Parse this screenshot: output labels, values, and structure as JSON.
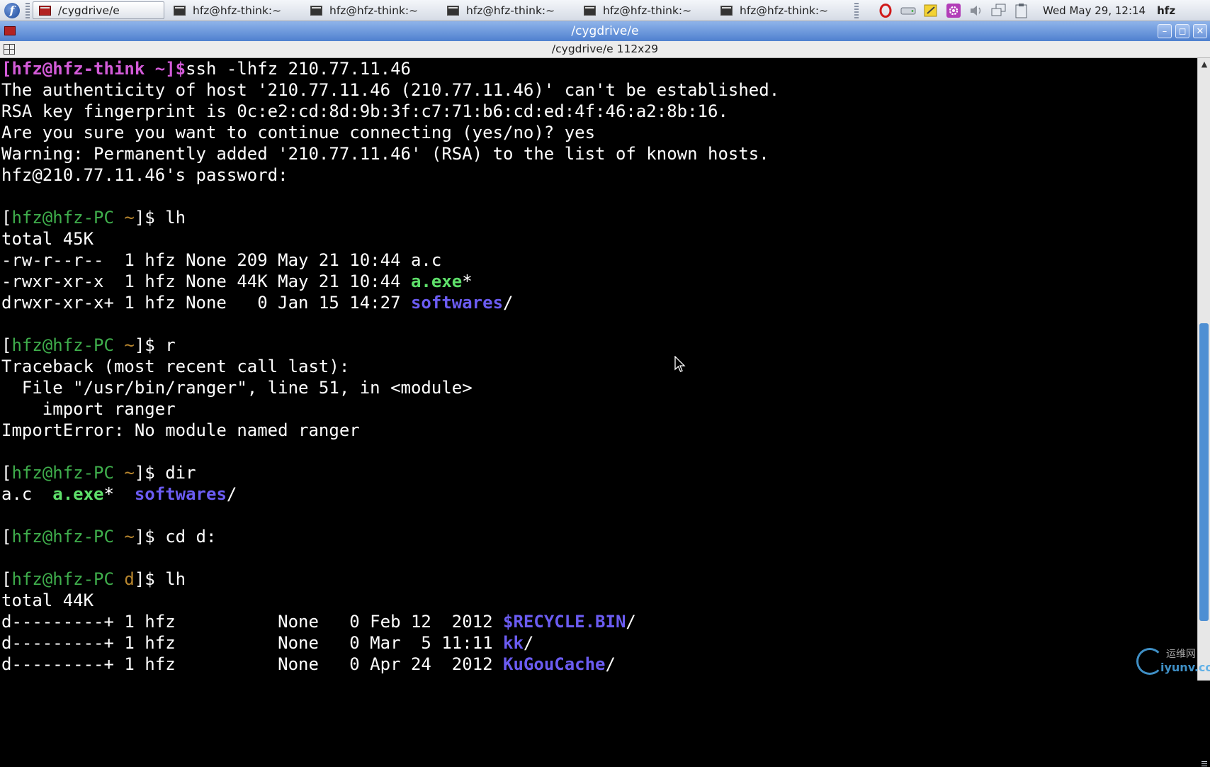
{
  "taskbar": {
    "start_label": "f",
    "tasks": [
      {
        "label": "/cygdrive/e",
        "active": true
      },
      {
        "label": "hfz@hfz-think:~",
        "active": false
      },
      {
        "label": "hfz@hfz-think:~",
        "active": false
      },
      {
        "label": "hfz@hfz-think:~",
        "active": false
      },
      {
        "label": "hfz@hfz-think:~",
        "active": false
      },
      {
        "label": "hfz@hfz-think:~",
        "active": false
      }
    ],
    "clock": "Wed May 29, 12:14",
    "user": "hfz",
    "tray_icons": [
      "opera-icon",
      "drive-icon",
      "notes-icon",
      "settings-icon",
      "volume-icon",
      "network-icon",
      "clipboard-icon"
    ]
  },
  "window": {
    "title": "/cygdrive/e",
    "info": "/cygdrive/e 112x29",
    "controls": {
      "minimize": "–",
      "maximize": "◻",
      "close": "✕"
    }
  },
  "terminal": {
    "lines": [
      [
        {
          "t": "[hfz@hfz-think ~]$",
          "c": "pr-old"
        },
        {
          "t": "ssh -lhfz 210.77.11.46",
          "c": "cmd"
        }
      ],
      [
        {
          "t": "The authenticity of host '210.77.11.46 (210.77.11.46)' can't be established.",
          "c": "cmd"
        }
      ],
      [
        {
          "t": "RSA key fingerprint is 0c:e2:cd:8d:9b:3f:c7:71:b6:cd:ed:4f:46:a2:8b:16.",
          "c": "cmd"
        }
      ],
      [
        {
          "t": "Are you sure you want to continue connecting (yes/no)? yes",
          "c": "cmd"
        }
      ],
      [
        {
          "t": "Warning: Permanently added '210.77.11.46' (RSA) to the list of known hosts.",
          "c": "cmd"
        }
      ],
      [
        {
          "t": "hfz@210.77.11.46's password:",
          "c": "cmd"
        }
      ],
      [],
      [
        {
          "t": "[",
          "c": "pr-bracket"
        },
        {
          "t": "hfz@hfz-PC",
          "c": "pr-user"
        },
        {
          "t": " ~",
          "c": "pr-dir"
        },
        {
          "t": "]$ lh",
          "c": "cmd"
        }
      ],
      [
        {
          "t": "total 45K",
          "c": "cmd"
        }
      ],
      [
        {
          "t": "-rw-r--r--  1 hfz None 209 May 21 10:44 a.c",
          "c": "cmd"
        }
      ],
      [
        {
          "t": "-rwxr-xr-x  1 hfz None 44K May 21 10:44 ",
          "c": "cmd"
        },
        {
          "t": "a.exe",
          "c": "exe"
        },
        {
          "t": "*",
          "c": "cmd"
        }
      ],
      [
        {
          "t": "drwxr-xr-x+ 1 hfz None   0 Jan 15 14:27 ",
          "c": "cmd"
        },
        {
          "t": "softwares",
          "c": "dirname"
        },
        {
          "t": "/",
          "c": "cmd"
        }
      ],
      [],
      [
        {
          "t": "[",
          "c": "pr-bracket"
        },
        {
          "t": "hfz@hfz-PC",
          "c": "pr-user"
        },
        {
          "t": " ~",
          "c": "pr-dir"
        },
        {
          "t": "]$ r",
          "c": "cmd"
        }
      ],
      [
        {
          "t": "Traceback (most recent call last):",
          "c": "cmd"
        }
      ],
      [
        {
          "t": "  File \"/usr/bin/ranger\", line 51, in <module>",
          "c": "cmd"
        }
      ],
      [
        {
          "t": "    import ranger",
          "c": "cmd"
        }
      ],
      [
        {
          "t": "ImportError: No module named ranger",
          "c": "cmd"
        }
      ],
      [],
      [
        {
          "t": "[",
          "c": "pr-bracket"
        },
        {
          "t": "hfz@hfz-PC",
          "c": "pr-user"
        },
        {
          "t": " ~",
          "c": "pr-dir"
        },
        {
          "t": "]$ dir",
          "c": "cmd"
        }
      ],
      [
        {
          "t": "a.c  ",
          "c": "cmd"
        },
        {
          "t": "a.exe",
          "c": "exe"
        },
        {
          "t": "*  ",
          "c": "cmd"
        },
        {
          "t": "softwares",
          "c": "dirname"
        },
        {
          "t": "/",
          "c": "cmd"
        }
      ],
      [],
      [
        {
          "t": "[",
          "c": "pr-bracket"
        },
        {
          "t": "hfz@hfz-PC",
          "c": "pr-user"
        },
        {
          "t": " ~",
          "c": "pr-dir"
        },
        {
          "t": "]$ cd d:",
          "c": "cmd"
        }
      ],
      [],
      [
        {
          "t": "[",
          "c": "pr-bracket"
        },
        {
          "t": "hfz@hfz-PC",
          "c": "pr-user"
        },
        {
          "t": " d",
          "c": "pr-dir"
        },
        {
          "t": "]$ lh",
          "c": "cmd"
        }
      ],
      [
        {
          "t": "total 44K",
          "c": "cmd"
        }
      ],
      [
        {
          "t": "d---------+ 1 hfz          None   0 Feb 12  2012 ",
          "c": "cmd"
        },
        {
          "t": "$RECYCLE.BIN",
          "c": "dirname"
        },
        {
          "t": "/",
          "c": "cmd"
        }
      ],
      [
        {
          "t": "d---------+ 1 hfz          None   0 Mar  5 11:11 ",
          "c": "cmd"
        },
        {
          "t": "kk",
          "c": "dirname"
        },
        {
          "t": "/",
          "c": "cmd"
        }
      ],
      [
        {
          "t": "d---------+ 1 hfz          None   0 Apr 24  2012 ",
          "c": "cmd"
        },
        {
          "t": "KuGouCache",
          "c": "dirname"
        },
        {
          "t": "/",
          "c": "cmd"
        }
      ]
    ]
  },
  "scrollbar": {
    "position": 0.65
  },
  "watermark": {
    "cn": "运维网",
    "url": "iyunv.com"
  },
  "colors": {
    "titlebar": "#5b8bd6",
    "prompt_user": "#3fae4c",
    "prompt_dir": "#b8862e",
    "executable": "#5ee06a",
    "directory": "#6b5cf2",
    "old_prompt": "#d35bd8"
  }
}
